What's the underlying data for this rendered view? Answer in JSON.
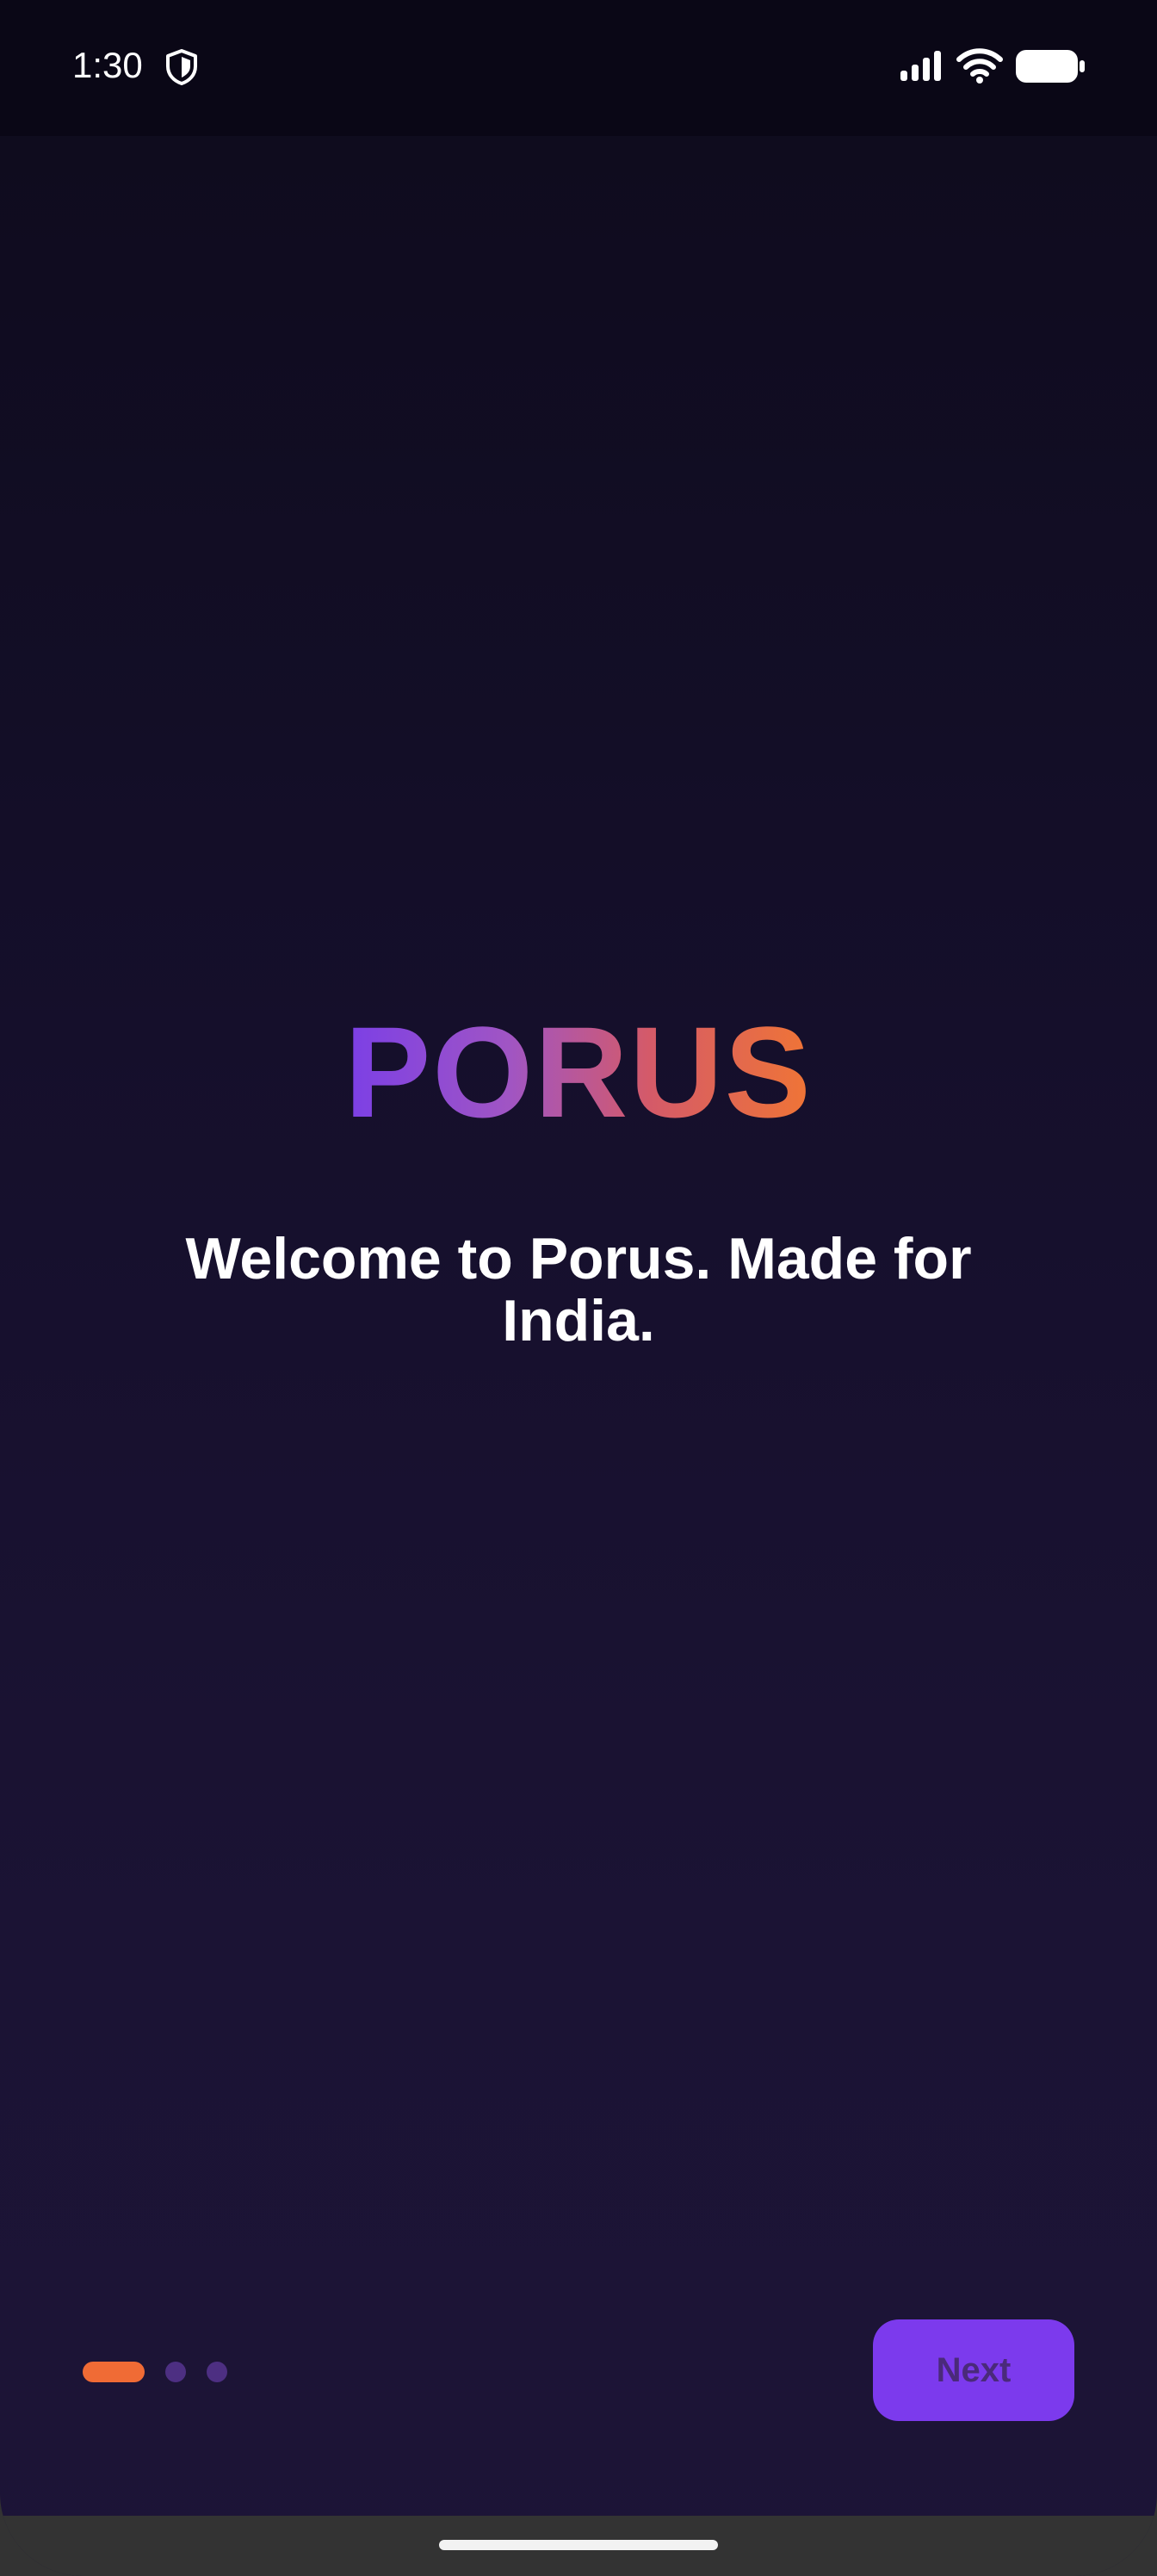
{
  "status_bar": {
    "time": "1:30",
    "icons": [
      "shield-icon",
      "signal-icon",
      "wifi-icon",
      "battery-icon"
    ]
  },
  "logo": {
    "text": "PORUS",
    "gradient_colors": [
      "#7b3fe6",
      "#a055c4",
      "#d45a69",
      "#f07535"
    ]
  },
  "welcome": {
    "message": "Welcome to Porus. Made for India."
  },
  "pager": {
    "current_page": 1,
    "total_pages": 3,
    "active_color": "#f06b35",
    "inactive_color": "#4d2f82"
  },
  "actions": {
    "next_label": "Next",
    "next_color": "#7c3aed"
  },
  "theme": {
    "background_top": "#0e0b1c",
    "background_bottom": "#1c1437"
  }
}
